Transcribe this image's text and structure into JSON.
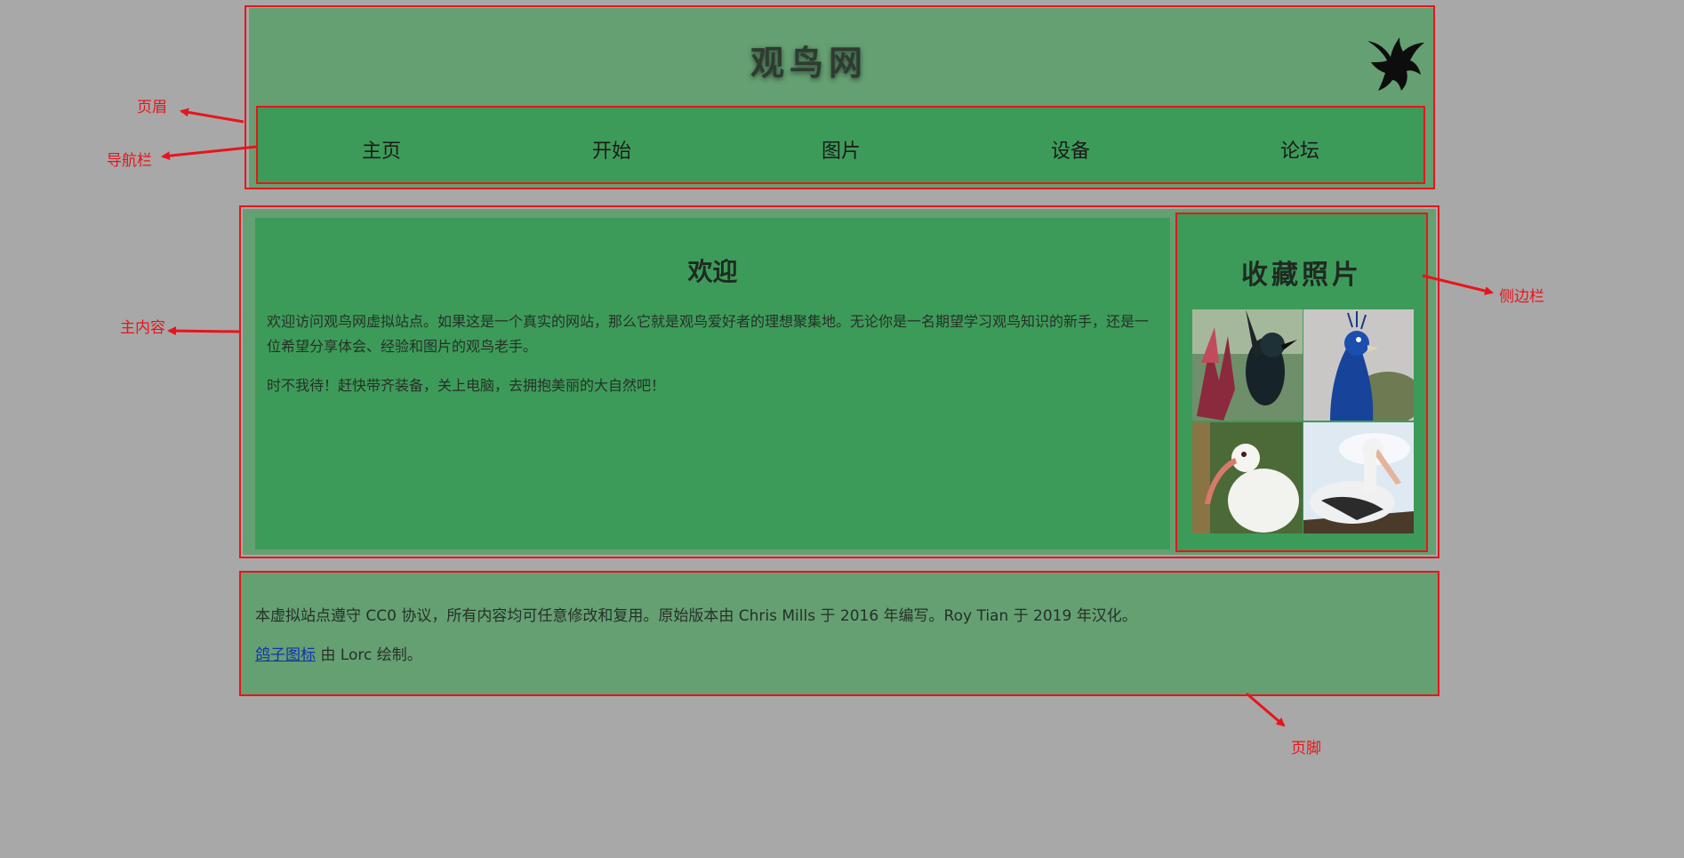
{
  "header": {
    "site_title": "观鸟网",
    "logo_icon": "bird-silhouette-icon"
  },
  "nav": {
    "items": [
      {
        "label": "主页"
      },
      {
        "label": "开始"
      },
      {
        "label": "图片"
      },
      {
        "label": "设备"
      },
      {
        "label": "论坛"
      }
    ]
  },
  "article": {
    "title": "欢迎",
    "paragraph1": "欢迎访问观鸟网虚拟站点。如果这是一个真实的网站，那么它就是观鸟爱好者的理想聚集地。无论你是一名期望学习观鸟知识的新手，还是一位希望分享体会、经验和图片的观鸟老手。",
    "paragraph2": "时不我待！赶快带齐装备，关上电脑，去拥抱美丽的大自然吧！"
  },
  "aside": {
    "title": "收藏照片",
    "photos": [
      {
        "icon": "tui-bird-photo"
      },
      {
        "icon": "peacock-photo"
      },
      {
        "icon": "ibis-photo"
      },
      {
        "icon": "pelican-photo"
      }
    ]
  },
  "footer": {
    "license_text": "本虚拟站点遵守 CC0 协议，所有内容均可任意修改和复用。原始版本由 Chris Mills 于 2016 年编写。Roy Tian 于 2019 年汉化。",
    "icon_link": "鸽子图标",
    "icon_credit": " 由 Lorc 绘制。"
  },
  "annotations": {
    "header_label": "页眉",
    "nav_label": "导航栏",
    "main_label": "主内容",
    "aside_label": "侧边栏",
    "footer_label": "页脚",
    "color": "#e8141c"
  },
  "colors": {
    "page_bg": "#a8a8a8",
    "header_bg": "#65a072",
    "nav_bg": "#3d9b59",
    "outline": "#e8141c"
  }
}
